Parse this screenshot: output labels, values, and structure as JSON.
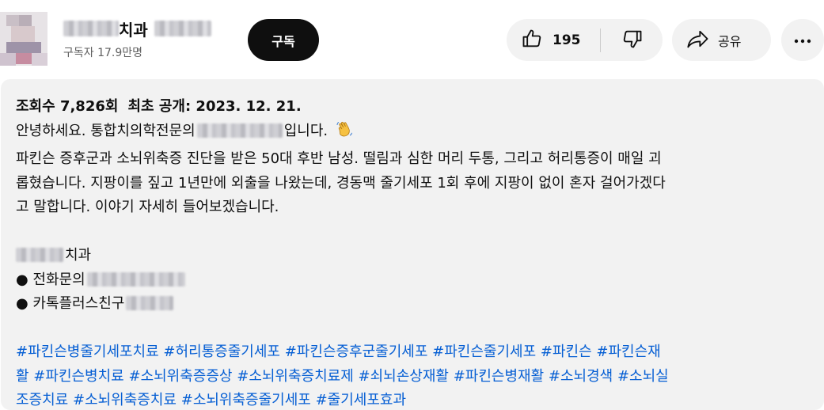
{
  "channel": {
    "name_suffix": "치과",
    "subscribers": "구독자 17.9만명"
  },
  "subscribe": {
    "label": "구독"
  },
  "actions": {
    "like_count": "195",
    "share_label": "공유"
  },
  "description": {
    "views": "조회수 7,826회",
    "date": "최초 공개: 2023. 12. 21.",
    "greeting_before": "안녕하세요. 통합치의학전문의",
    "greeting_after": "입니다.",
    "body_line1": "파킨슨 증후군과 소뇌위축증 진단을 받은  50대 후반 남성. 떨림과 심한 머리 두통, 그리고 허리통증이 매일 괴",
    "body_line2": "롭혔습니다. 지팡이를 짚고 1년만에 외출을 나왔는데, 경동맥 줄기세포 1회 후에 지팡이 없이 혼자 걸어가겠다",
    "body_line3": "고 말합니다. 이야기 자세히 들어보겠습니다.",
    "clinic_suffix": "치과",
    "phone_label": "● 전화문의",
    "kakao_label": "● 카톡플러스친구",
    "hashtags": [
      "#파킨슨병줄기세포치료",
      "#허리통증줄기세포",
      "#파킨슨증후군줄기세포",
      "#파킨슨줄기세포",
      "#파킨슨",
      "#파킨슨재",
      "활",
      "#파킨슨병치료",
      "#소뇌위축증증상",
      "#소뇌위축증치료제",
      "#쇠뇌손상재활",
      "#파킨슨병재활",
      "#소뇌경색",
      "#소뇌실",
      "조증치료",
      "#소뇌위축증치료",
      "#소뇌위축증줄기세포",
      "#줄기세포효과"
    ]
  }
}
